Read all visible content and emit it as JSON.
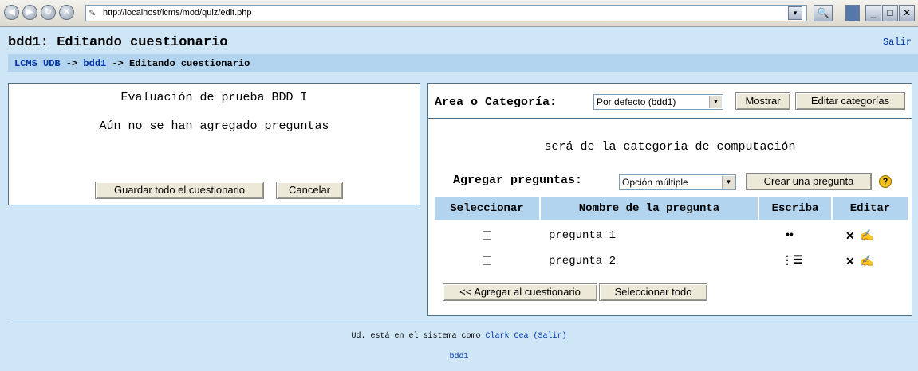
{
  "browser": {
    "url": "http://localhost/lcms/mod/quiz/edit.php",
    "back_icon": "back-arrow-icon",
    "forward_icon": "forward-arrow-icon",
    "refresh_icon": "refresh-icon",
    "stop_icon": "stop-icon",
    "search_icon": "search-icon",
    "window_buttons": [
      "_",
      "□",
      "✕"
    ]
  },
  "header": {
    "title": "bdd1: Editando cuestionario",
    "logout": "Salir"
  },
  "breadcrumb": {
    "home": "LCMS UDB",
    "sep1": " -> ",
    "course": "bdd1",
    "sep2": " -> ",
    "current": "Editando cuestionario"
  },
  "quiz": {
    "name": "Evaluación de prueba BDD I",
    "empty_message": "Aún no se han agregado preguntas",
    "save_label": "Guardar todo el cuestionario",
    "cancel_label": "Cancelar"
  },
  "category": {
    "label": "Area o Categoría:",
    "selected": "Por defecto (bdd1)",
    "show_label": "Mostrar",
    "edit_label": "Editar categorías",
    "description": "será de la categoria de computación"
  },
  "add_question": {
    "label": "Agregar preguntas:",
    "type_selected": "Opción múltiple",
    "create_label": "Crear una pregunta",
    "help": "?"
  },
  "table": {
    "headers": [
      "Seleccionar",
      "Nombre de la pregunta",
      "Escriba",
      "Editar"
    ],
    "rows": [
      {
        "name": "pregunta 1",
        "type_icon": "••",
        "delete": "✕",
        "edit": "✍"
      },
      {
        "name": "pregunta 2",
        "type_icon": "⋮☰",
        "delete": "✕",
        "edit": "✍"
      }
    ],
    "add_to_quiz_label": "<< Agregar al cuestionario",
    "select_all_label": "Seleccionar todo"
  },
  "footer": {
    "logged_prefix": "Ud. está en el sistema como ",
    "user": "Clark Cea",
    "logout": "(Salir)",
    "course": "bdd1"
  }
}
